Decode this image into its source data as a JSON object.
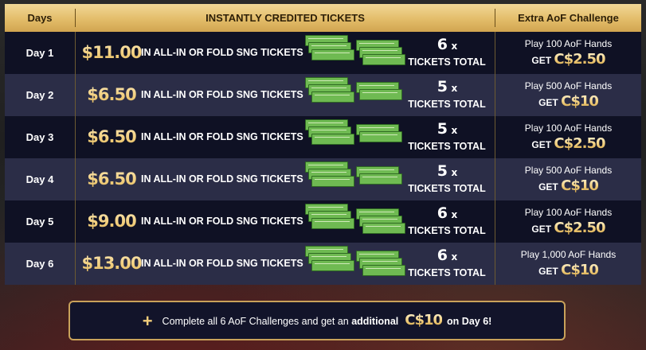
{
  "header": {
    "days": "Days",
    "instant": "INSTANTLY CREDITED TICKETS",
    "extra": "Extra AoF Challenge"
  },
  "rows": [
    {
      "day": "Day 1",
      "amount": "$11.00",
      "desc": "IN ALL-IN OR FOLD SNG TICKETS",
      "count": "6",
      "x": "x",
      "total": "TICKETS TOTAL",
      "play": "Play 100 AoF Hands",
      "get": "GET",
      "reward": "C$2.50"
    },
    {
      "day": "Day 2",
      "amount": "$6.50",
      "desc": "IN ALL-IN OR FOLD SNG TICKETS",
      "count": "5",
      "x": "x",
      "total": "TICKETS TOTAL",
      "play": "Play 500 AoF Hands",
      "get": "GET",
      "reward": "C$10"
    },
    {
      "day": "Day 3",
      "amount": "$6.50",
      "desc": "IN ALL-IN OR FOLD SNG TICKETS",
      "count": "5",
      "x": "x",
      "total": "TICKETS TOTAL",
      "play": "Play 100 AoF Hands",
      "get": "GET",
      "reward": "C$2.50"
    },
    {
      "day": "Day 4",
      "amount": "$6.50",
      "desc": "IN ALL-IN OR FOLD SNG TICKETS",
      "count": "5",
      "x": "x",
      "total": "TICKETS TOTAL",
      "play": "Play 500 AoF Hands",
      "get": "GET",
      "reward": "C$10"
    },
    {
      "day": "Day 5",
      "amount": "$9.00",
      "desc": "IN ALL-IN OR FOLD SNG TICKETS",
      "count": "6",
      "x": "x",
      "total": "TICKETS TOTAL",
      "play": "Play 100 AoF Hands",
      "get": "GET",
      "reward": "C$2.50"
    },
    {
      "day": "Day 6",
      "amount": "$13.00",
      "desc": "IN ALL-IN OR FOLD SNG TICKETS",
      "count": "6",
      "x": "x",
      "total": "TICKETS TOTAL",
      "play": "Play 1,000 AoF Hands",
      "get": "GET",
      "reward": "C$10"
    }
  ],
  "banner": {
    "plus": "+",
    "text1": "Complete all 6 AoF Challenges and get an",
    "bold": "additional",
    "amount": "C$10",
    "text2": "on Day 6!"
  },
  "colors": {
    "header_gold": "#e3bd6a",
    "row_dark": "#0f1124",
    "row_light": "#2b2d47",
    "ticket_green": "#6fba52",
    "amount_gold": "#f1cd7a"
  },
  "icons": {
    "ticket": "ticket-stack-icon",
    "plus": "plus-icon"
  }
}
